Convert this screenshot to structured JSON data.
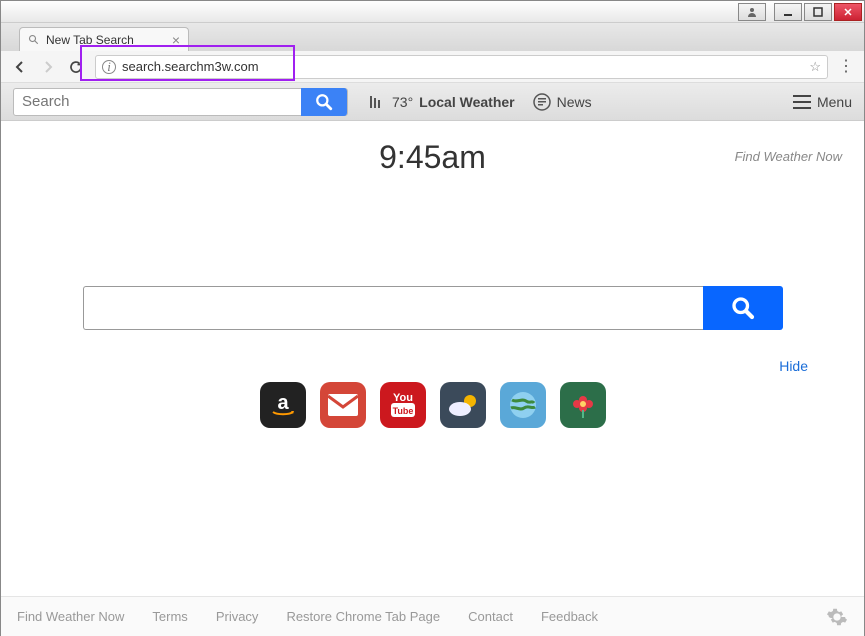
{
  "window": {
    "tab_title": "New Tab Search"
  },
  "address": {
    "url": "search.searchm3w.com"
  },
  "toolbar": {
    "search_placeholder": "Search",
    "weather_temp": "73°",
    "weather_label": "Local Weather",
    "news_label": "News",
    "menu_label": "Menu"
  },
  "main": {
    "time": "9:45am",
    "brand": "Find Weather Now",
    "hide_label": "Hide"
  },
  "shortcuts": [
    {
      "name": "amazon",
      "bg": "#222"
    },
    {
      "name": "gmail",
      "bg": "#d44638"
    },
    {
      "name": "youtube",
      "bg": "#cc181e"
    },
    {
      "name": "weather",
      "bg": "#3b4a5a"
    },
    {
      "name": "globe",
      "bg": "#5aa8d8"
    },
    {
      "name": "flower",
      "bg": "#2c6e49"
    }
  ],
  "footer": {
    "links": [
      "Find Weather Now",
      "Terms",
      "Privacy",
      "Restore Chrome Tab Page",
      "Contact",
      "Feedback"
    ]
  }
}
